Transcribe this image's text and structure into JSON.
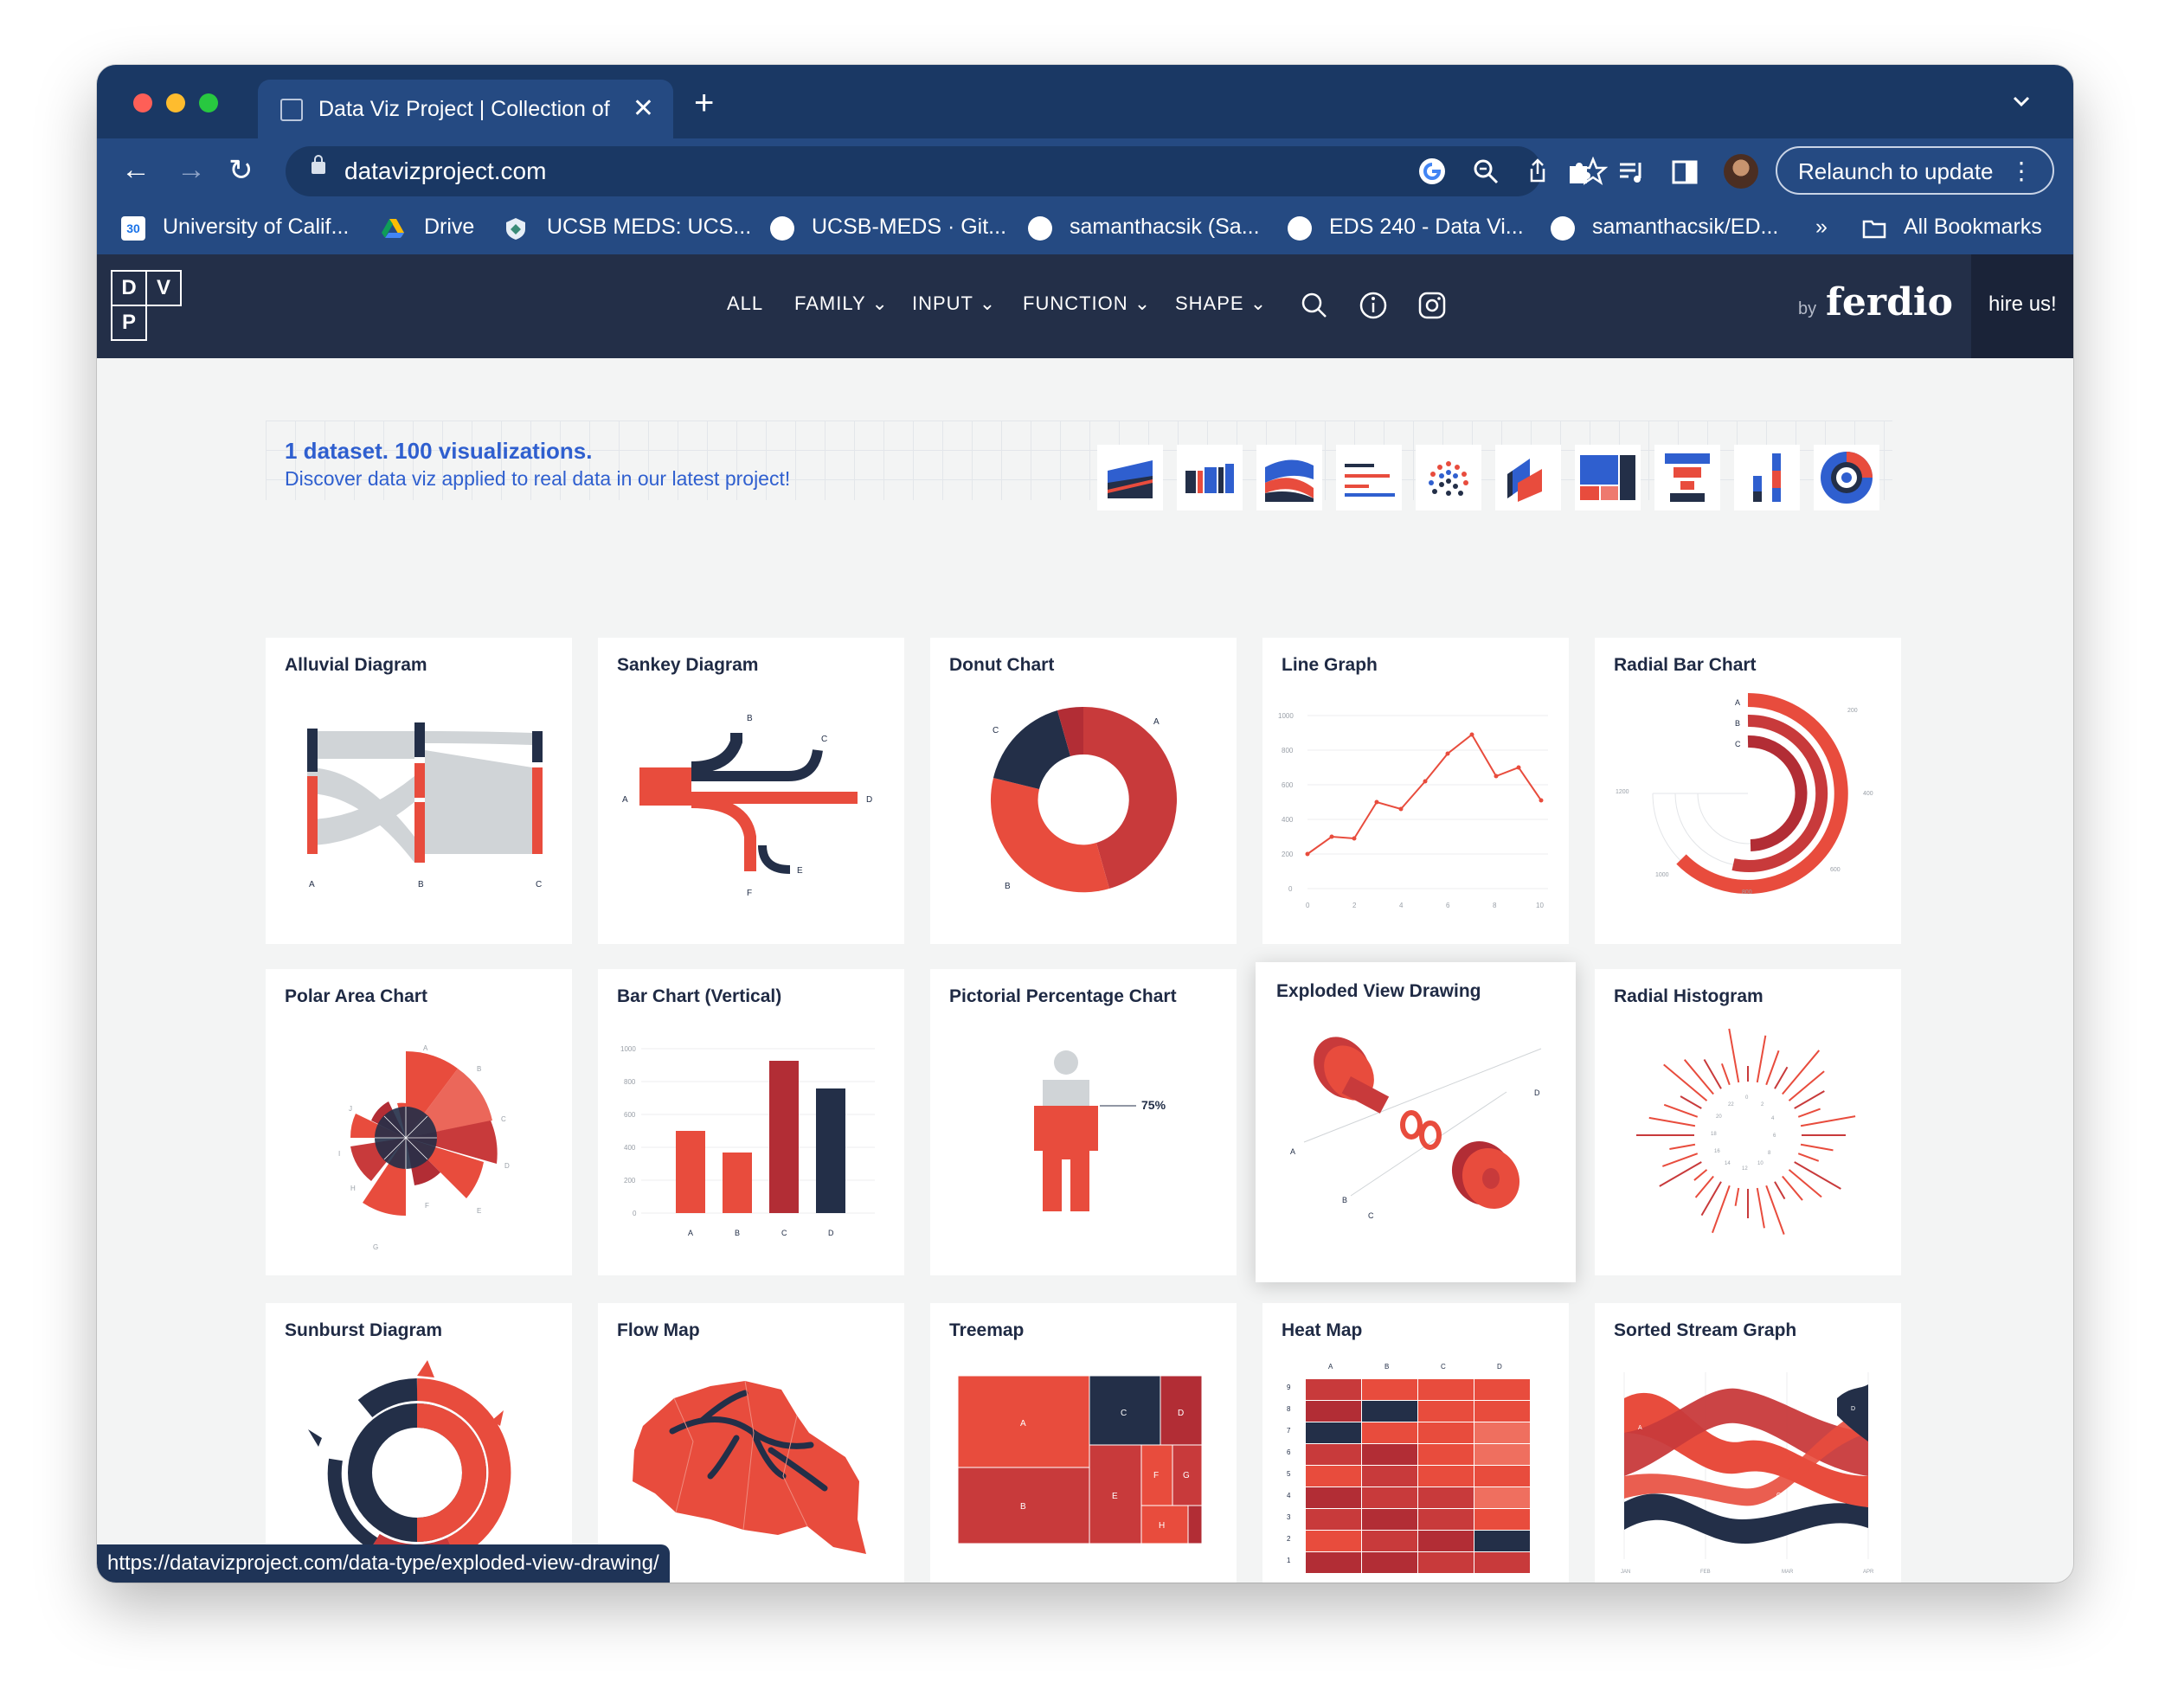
{
  "browser": {
    "tab_title": "Data Viz Project | Collection of",
    "url": "datavizproject.com",
    "relaunch_label": "Relaunch to update",
    "status_url": "https://datavizproject.com/data-type/exploded-view-drawing/",
    "bookmarks": [
      "University of Calif...",
      "Drive",
      "UCSB MEDS: UCS...",
      "UCSB-MEDS · Git...",
      "samanthacsik (Sa...",
      "EDS 240 - Data Vi...",
      "samanthacsik/ED..."
    ],
    "overflow_label": "»",
    "all_bookmarks_label": "All Bookmarks",
    "calendar_badge": "30",
    "colors": {
      "frame": "#1a3864",
      "toolbar": "#254a82"
    }
  },
  "site": {
    "logo_letters": [
      "D",
      "V",
      "P"
    ],
    "menu": [
      "ALL",
      "FAMILY",
      "INPUT",
      "FUNCTION",
      "SHAPE"
    ],
    "by_label": "by",
    "brand": "ferdio",
    "hire_label": "hire us!",
    "colors": {
      "nav": "#232f48",
      "red": "#e84c3d",
      "dark_red": "#b22d35",
      "navy": "#232f48",
      "blue": "#2f5fcf"
    }
  },
  "banner": {
    "title": "1 dataset. 100 visualizations.",
    "subtitle": "Discover data viz applied to real data in our latest project!"
  },
  "cards": [
    {
      "title": "Alluvial Diagram",
      "labels": [
        "A",
        "B",
        "C"
      ]
    },
    {
      "title": "Sankey Diagram",
      "labels": [
        "A",
        "B",
        "C",
        "D",
        "E",
        "F"
      ]
    },
    {
      "title": "Donut Chart",
      "labels": [
        "A",
        "B",
        "C"
      ]
    },
    {
      "title": "Line Graph",
      "y_ticks": [
        "1000",
        "800",
        "600",
        "400",
        "200",
        "0"
      ],
      "x_ticks": [
        "0",
        "2",
        "4",
        "6",
        "8",
        "10"
      ]
    },
    {
      "title": "Radial Bar Chart",
      "labels": [
        "A",
        "B",
        "C"
      ],
      "ticks": [
        "200",
        "400",
        "600",
        "800",
        "1000",
        "1200"
      ]
    },
    {
      "title": "Polar Area Chart",
      "labels": [
        "A",
        "B",
        "C",
        "D",
        "E",
        "F",
        "G",
        "H",
        "I",
        "J"
      ]
    },
    {
      "title": "Bar Chart (Vertical)",
      "y_ticks": [
        "1000",
        "800",
        "600",
        "400",
        "200",
        "0"
      ],
      "x_labels": [
        "A",
        "B",
        "C",
        "D"
      ]
    },
    {
      "title": "Pictorial Percentage Chart",
      "value": "75%"
    },
    {
      "title": "Exploded View Drawing",
      "labels": [
        "A",
        "B",
        "C",
        "D"
      ]
    },
    {
      "title": "Radial Histogram",
      "ticks": [
        "0",
        "2",
        "4",
        "6",
        "8",
        "10",
        "12",
        "14",
        "16",
        "18",
        "20",
        "22"
      ]
    },
    {
      "title": "Sunburst Diagram"
    },
    {
      "title": "Flow Map"
    },
    {
      "title": "Treemap",
      "labels": [
        "A",
        "B",
        "C",
        "D",
        "E",
        "F",
        "G",
        "H"
      ]
    },
    {
      "title": "Heat Map",
      "cols": [
        "A",
        "B",
        "C",
        "D"
      ],
      "rows": [
        "9",
        "8",
        "7",
        "6",
        "5",
        "4",
        "3",
        "2",
        "1"
      ]
    },
    {
      "title": "Sorted Stream Graph",
      "labels": [
        "A",
        "B",
        "C",
        "D"
      ],
      "months": [
        "JAN",
        "FEB",
        "MAR",
        "APR"
      ]
    }
  ]
}
